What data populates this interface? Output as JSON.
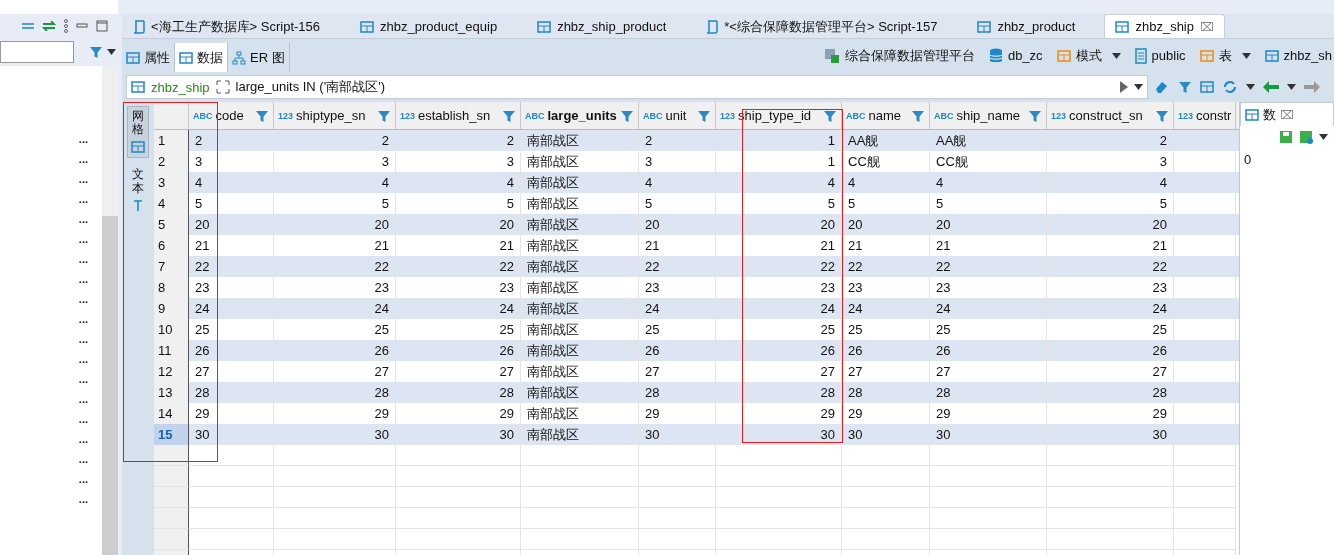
{
  "navigator": {
    "items": [
      "...",
      "...",
      "...",
      "...",
      "...",
      "...",
      "...",
      "...",
      "...",
      "...",
      "...",
      "...",
      "...",
      "...",
      "...",
      "...",
      "...",
      "...",
      "..."
    ]
  },
  "editor_tabs": [
    {
      "label": "<海工生产数据库> Script-156",
      "kind": "script",
      "selected": false
    },
    {
      "label": "zhbz_product_equip",
      "kind": "table",
      "selected": false
    },
    {
      "label": "zhbz_ship_product",
      "kind": "table",
      "selected": false
    },
    {
      "label": "*<综合保障数据管理平台> Script-157",
      "kind": "script",
      "selected": false
    },
    {
      "label": "zhbz_product",
      "kind": "table",
      "selected": false
    },
    {
      "label": "zhbz_ship",
      "kind": "table",
      "selected": true,
      "close": "⌧"
    }
  ],
  "view_tabs": [
    {
      "label": "属性",
      "kind": "table",
      "selected": false
    },
    {
      "label": "数据",
      "kind": "data",
      "selected": true
    },
    {
      "label": "ER 图",
      "kind": "er",
      "selected": false
    }
  ],
  "breadcrumb": [
    {
      "label": "综合保障数据管理平台",
      "kind": "connection",
      "dropdown": false
    },
    {
      "label": "db_zc",
      "kind": "database",
      "dropdown": false
    },
    {
      "label": "模式",
      "kind": "schema",
      "dropdown": true
    },
    {
      "label": "public",
      "kind": "document",
      "dropdown": false
    },
    {
      "label": "表",
      "kind": "tables",
      "dropdown": true
    },
    {
      "label": "zhbz_sh",
      "kind": "table",
      "dropdown": false
    }
  ],
  "filter": {
    "table": "zhbz_ship",
    "value": "large_units IN ('南部战区')"
  },
  "side_tabs": [
    {
      "label": "网格",
      "selected": true
    },
    {
      "label": "文本",
      "selected": false
    }
  ],
  "grid": {
    "columns": [
      {
        "label": "code",
        "type": "ABC",
        "emphasized": false
      },
      {
        "label": "shiptype_sn",
        "type": "123",
        "emphasized": false
      },
      {
        "label": "establish_sn",
        "type": "123",
        "emphasized": false
      },
      {
        "label": "large_units",
        "type": "ABC",
        "emphasized": true
      },
      {
        "label": "unit",
        "type": "ABC",
        "emphasized": false
      },
      {
        "label": "ship_type_id",
        "type": "123",
        "emphasized": false
      },
      {
        "label": "name",
        "type": "ABC",
        "emphasized": false
      },
      {
        "label": "ship_name",
        "type": "ABC",
        "emphasized": false
      },
      {
        "label": "construct_sn",
        "type": "123",
        "emphasized": false
      },
      {
        "label": "constr",
        "type": "123",
        "emphasized": false
      }
    ],
    "rows": [
      {
        "number": "1",
        "selected": false,
        "cells": [
          "2",
          "2",
          "2",
          "南部战区",
          "2",
          "1",
          "AA舰",
          "AA舰",
          "2"
        ]
      },
      {
        "number": "2",
        "selected": false,
        "cells": [
          "3",
          "3",
          "3",
          "南部战区",
          "3",
          "1",
          "CC舰",
          "CC舰",
          "3"
        ]
      },
      {
        "number": "3",
        "selected": false,
        "cells": [
          "4",
          "4",
          "4",
          "南部战区",
          "4",
          "4",
          "4",
          "4",
          "4"
        ]
      },
      {
        "number": "4",
        "selected": false,
        "cells": [
          "5",
          "5",
          "5",
          "南部战区",
          "5",
          "5",
          "5",
          "5",
          "5"
        ]
      },
      {
        "number": "5",
        "selected": false,
        "cells": [
          "20",
          "20",
          "20",
          "南部战区",
          "20",
          "20",
          "20",
          "20",
          "20"
        ]
      },
      {
        "number": "6",
        "selected": false,
        "cells": [
          "21",
          "21",
          "21",
          "南部战区",
          "21",
          "21",
          "21",
          "21",
          "21"
        ]
      },
      {
        "number": "7",
        "selected": false,
        "cells": [
          "22",
          "22",
          "22",
          "南部战区",
          "22",
          "22",
          "22",
          "22",
          "22"
        ]
      },
      {
        "number": "8",
        "selected": false,
        "cells": [
          "23",
          "23",
          "23",
          "南部战区",
          "23",
          "23",
          "23",
          "23",
          "23"
        ]
      },
      {
        "number": "9",
        "selected": false,
        "cells": [
          "24",
          "24",
          "24",
          "南部战区",
          "24",
          "24",
          "24",
          "24",
          "24"
        ]
      },
      {
        "number": "10",
        "selected": false,
        "cells": [
          "25",
          "25",
          "25",
          "南部战区",
          "25",
          "25",
          "25",
          "25",
          "25"
        ]
      },
      {
        "number": "11",
        "selected": false,
        "cells": [
          "26",
          "26",
          "26",
          "南部战区",
          "26",
          "26",
          "26",
          "26",
          "26"
        ]
      },
      {
        "number": "12",
        "selected": false,
        "cells": [
          "27",
          "27",
          "27",
          "南部战区",
          "27",
          "27",
          "27",
          "27",
          "27"
        ]
      },
      {
        "number": "13",
        "selected": false,
        "cells": [
          "28",
          "28",
          "28",
          "南部战区",
          "28",
          "28",
          "28",
          "28",
          "28"
        ]
      },
      {
        "number": "14",
        "selected": false,
        "cells": [
          "29",
          "29",
          "29",
          "南部战区",
          "29",
          "29",
          "29",
          "29",
          "29"
        ]
      },
      {
        "number": "15",
        "selected": true,
        "cells": [
          "30",
          "30",
          "30",
          "南部战区",
          "30",
          "30",
          "30",
          "30",
          "30"
        ]
      }
    ]
  },
  "value_panel": {
    "tab": "数",
    "close": "⌧",
    "value": "0"
  }
}
